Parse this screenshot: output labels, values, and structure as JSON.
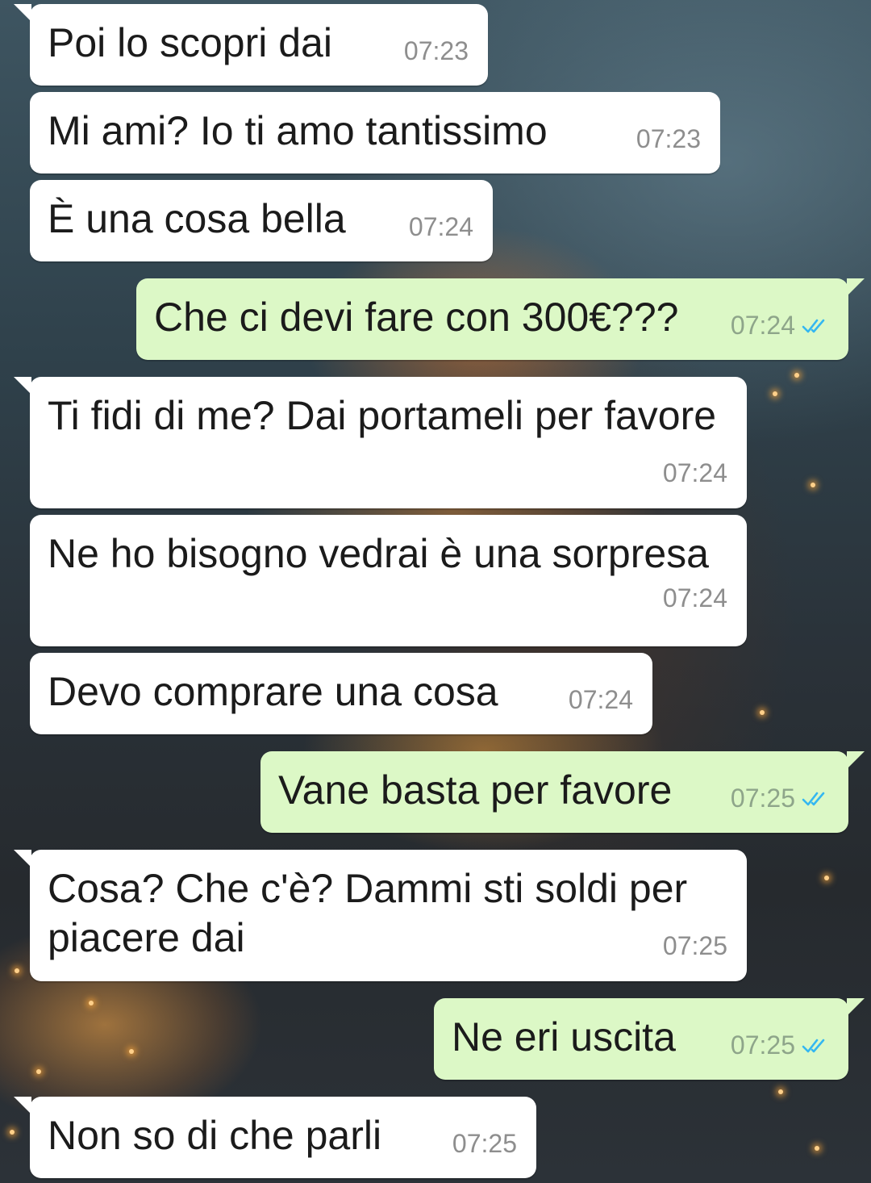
{
  "colors": {
    "incoming_bubble": "#ffffff",
    "outgoing_bubble": "#dcf8c6",
    "timestamp": "#8e8e8e",
    "read_ticks": "#34b7f1"
  },
  "messages": [
    {
      "direction": "incoming",
      "text": "Poi lo scopri dai",
      "time": "07:23"
    },
    {
      "direction": "incoming",
      "text": "Mi ami? Io ti amo tantissimo",
      "time": "07:23"
    },
    {
      "direction": "incoming",
      "text": "È una cosa bella",
      "time": "07:24"
    },
    {
      "direction": "outgoing",
      "text": "Che ci devi fare con 300€???",
      "time": "07:24",
      "status_icon": "double-check-read-icon"
    },
    {
      "direction": "incoming",
      "text": "Ti fidi di me? Dai portameli per favore",
      "time": "07:24"
    },
    {
      "direction": "incoming",
      "text": "Ne ho bisogno vedrai è una sorpresa",
      "time": "07:24"
    },
    {
      "direction": "incoming",
      "text": "Devo comprare una cosa",
      "time": "07:24"
    },
    {
      "direction": "outgoing",
      "text": "Vane basta per favore",
      "time": "07:25",
      "status_icon": "double-check-read-icon"
    },
    {
      "direction": "incoming",
      "text": "Cosa? Che c'è? Dammi sti soldi per piacere dai",
      "time": "07:25"
    },
    {
      "direction": "outgoing",
      "text": "Ne eri uscita",
      "time": "07:25",
      "status_icon": "double-check-read-icon"
    },
    {
      "direction": "incoming",
      "text": "Non so di che parli",
      "time": "07:25"
    }
  ]
}
